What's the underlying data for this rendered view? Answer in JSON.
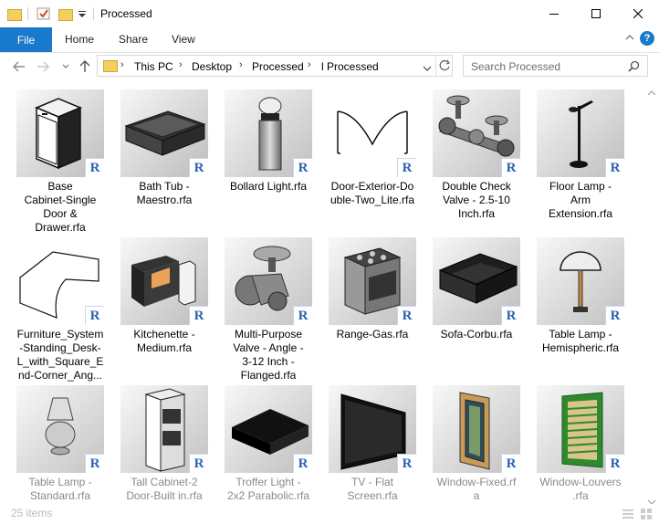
{
  "window": {
    "title": "Processed"
  },
  "ribbon": {
    "tabs": [
      "File",
      "Home",
      "Share",
      "View"
    ]
  },
  "address": {
    "crumbs": [
      "This PC",
      "Desktop",
      "Processed",
      "l Processed"
    ]
  },
  "search": {
    "placeholder": "Search Processed"
  },
  "items": [
    {
      "name": "Base Cabinet-Single Door & Drawer.rfa",
      "lines": [
        "Base",
        "Cabinet-Single",
        "Door &",
        "Drawer.rfa"
      ],
      "thumb": "cabinet"
    },
    {
      "name": "Bath Tub - Maestro.rfa",
      "lines": [
        "Bath Tub -",
        "Maestro.rfa"
      ],
      "thumb": "bathtub"
    },
    {
      "name": "Bollard Light.rfa",
      "lines": [
        "Bollard Light.rfa"
      ],
      "thumb": "bollard"
    },
    {
      "name": "Door-Exterior-Double-Two_Lite.rfa",
      "lines": [
        "Door-Exterior-Do",
        "uble-Two_Lite.rfa"
      ],
      "thumb": "door"
    },
    {
      "name": "Double Check Valve - 2.5-10 Inch.rfa",
      "lines": [
        "Double Check",
        "Valve - 2.5-10",
        "Inch.rfa"
      ],
      "thumb": "valve"
    },
    {
      "name": "Floor Lamp - Arm Extension.rfa",
      "lines": [
        "Floor Lamp -",
        "Arm",
        "Extension.rfa"
      ],
      "thumb": "floorlamp"
    },
    {
      "name": "Furniture_System-Standing_Desk-L_with_Square_End-Corner_Ang...",
      "lines": [
        "Furniture_System",
        "-Standing_Desk-",
        "L_with_Square_E",
        "nd-Corner_Ang..."
      ],
      "thumb": "desk"
    },
    {
      "name": "Kitchenette - Medium.rfa",
      "lines": [
        "Kitchenette -",
        "Medium.rfa"
      ],
      "thumb": "kitchen"
    },
    {
      "name": "Multi-Purpose Valve - Angle - 3-12 Inch - Flanged.rfa",
      "lines": [
        "Multi-Purpose",
        "Valve - Angle -",
        "3-12 Inch -",
        "Flanged.rfa"
      ],
      "thumb": "mvalve"
    },
    {
      "name": "Range-Gas.rfa",
      "lines": [
        "Range-Gas.rfa"
      ],
      "thumb": "range"
    },
    {
      "name": "Sofa-Corbu.rfa",
      "lines": [
        "Sofa-Corbu.rfa"
      ],
      "thumb": "sofa"
    },
    {
      "name": "Table Lamp - Hemispheric.rfa",
      "lines": [
        "Table Lamp -",
        "Hemispheric.rfa"
      ],
      "thumb": "tablelamp"
    },
    {
      "name": "Table Lamp - Standard.rfa",
      "lines": [
        "Table Lamp -",
        "Standard.rfa"
      ],
      "thumb": "lampstd"
    },
    {
      "name": "Tall Cabinet-2 Door-Built in.rfa",
      "lines": [
        "Tall Cabinet-2",
        "Door-Built in.rfa"
      ],
      "thumb": "tallcab"
    },
    {
      "name": "Troffer Light - 2x2 Parabolic.rfa",
      "lines": [
        "Troffer Light -",
        "2x2 Parabolic.rfa"
      ],
      "thumb": "troffer"
    },
    {
      "name": "TV - Flat Screen.rfa",
      "lines": [
        "TV - Flat",
        "Screen.rfa"
      ],
      "thumb": "tv"
    },
    {
      "name": "Window-Fixed.rfa",
      "lines": [
        "Window-Fixed.rf",
        "a"
      ],
      "thumb": "winfixed"
    },
    {
      "name": "Window-Louvers.rfa",
      "lines": [
        "Window-Louvers",
        ".rfa"
      ],
      "thumb": "winlouver"
    }
  ],
  "badge_letter": "R",
  "status": {
    "count": "25 items"
  },
  "colors": {
    "accent": "#1979ca",
    "badge": "#2a61b5"
  }
}
